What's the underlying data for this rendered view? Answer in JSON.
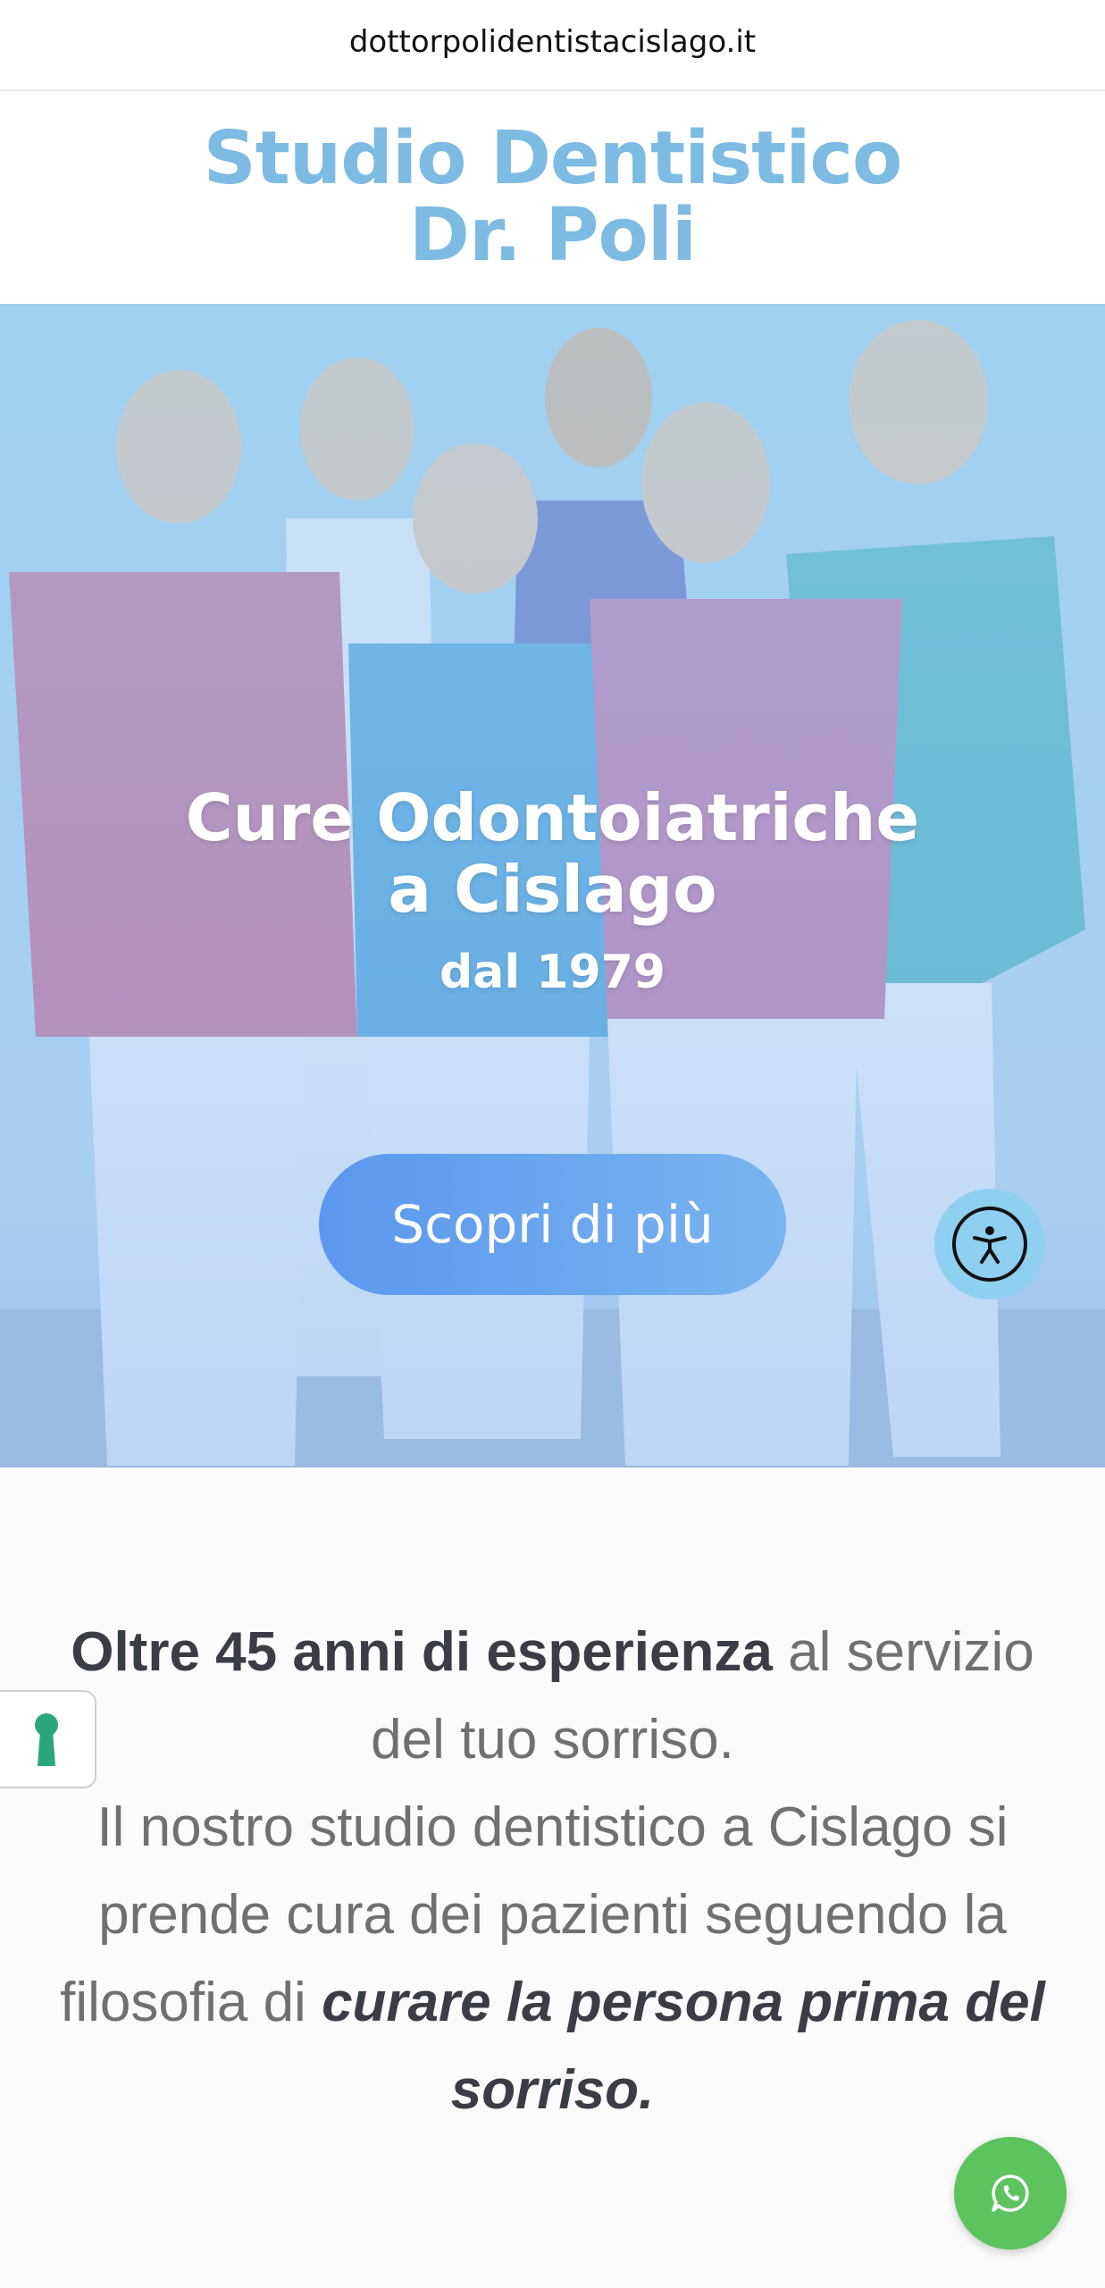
{
  "browser": {
    "url": "dottorpolidentistacislago.it"
  },
  "header": {
    "title_line1": "Studio Dentistico",
    "title_line2": "Dr. Poli"
  },
  "hero": {
    "headline_line1": "Cure Odontoiatriche",
    "headline_line2": "a Cislago",
    "subheadline": "dal 1979",
    "cta_label": "Scopri di più",
    "photo": "team-photo"
  },
  "intro": {
    "part1_bold": "Oltre 45 anni di esperienza",
    "part1_rest": " al servizio del tuo sorriso.",
    "part2": "Il nostro studio dentistico a Cislago si prende cura dei pazienti seguendo la filosofia di ",
    "part2_bold_italic": "curare la persona prima del sorriso",
    "part2_end": "."
  },
  "widgets": {
    "accessibility_icon": "accessibility-icon",
    "cookie_icon": "keyhole-icon",
    "whatsapp_icon": "whatsapp-icon"
  },
  "colors": {
    "brand_title": "#7dbbe2",
    "cta_gradient_start": "#5b97ee",
    "cta_gradient_end": "#79b4ef",
    "whatsapp": "#5cc35e",
    "text_dark": "#3a3d45",
    "text_muted": "#707070"
  }
}
